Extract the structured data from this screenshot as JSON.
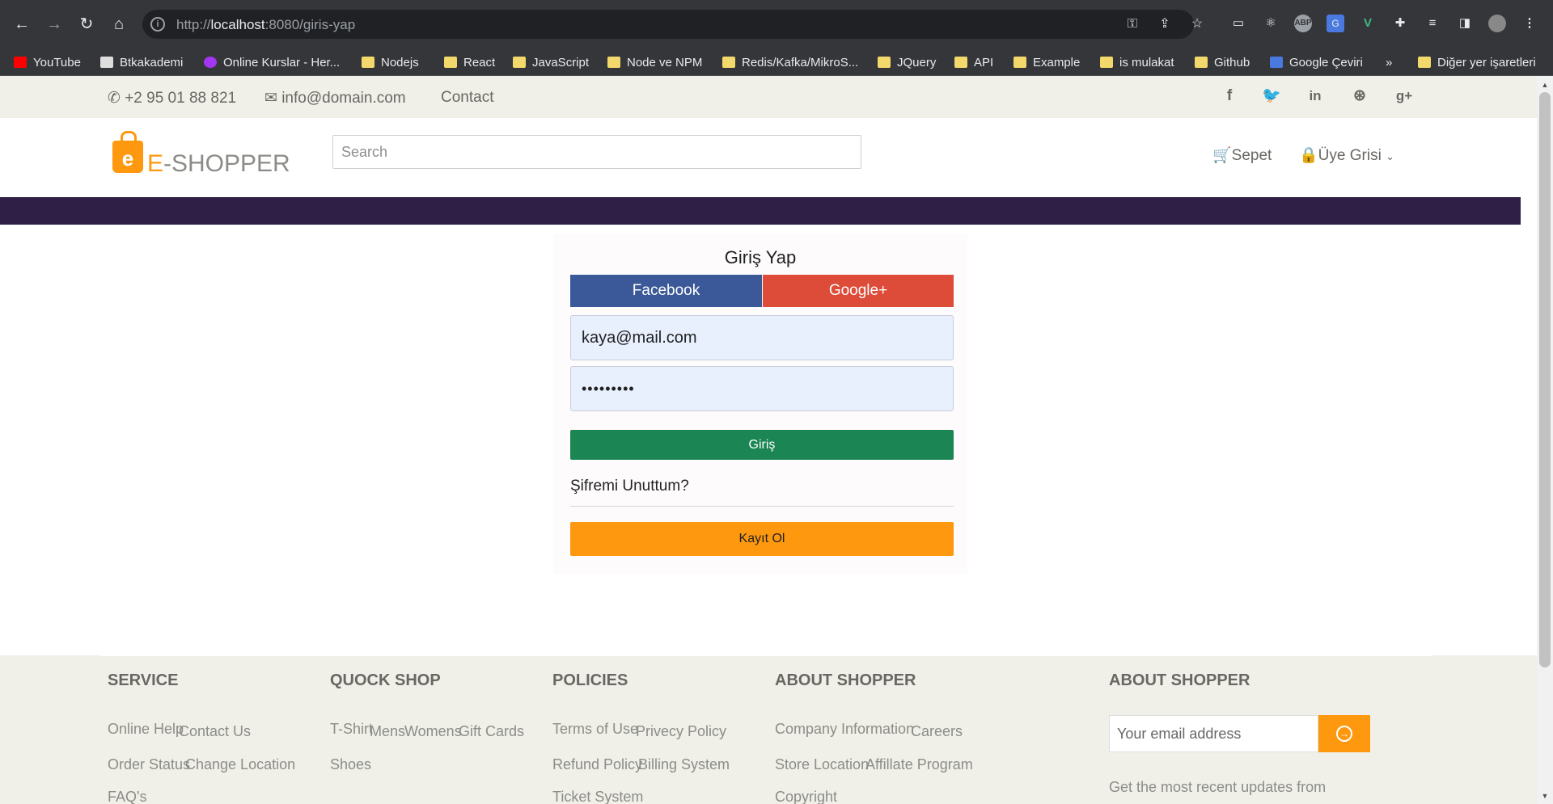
{
  "browser": {
    "url_scheme": "http://",
    "url_host": "localhost",
    "url_path": ":8080/giris-yap",
    "bookmarks": [
      {
        "label": "YouTube",
        "icon": "youtube-icon"
      },
      {
        "label": "Btkakademi",
        "icon": "btk-icon"
      },
      {
        "label": "Online Kurslar - Her...",
        "icon": "udemy-icon"
      },
      {
        "label": "Nodejs",
        "icon": "folder-icon"
      },
      {
        "label": "React",
        "icon": "folder-icon"
      },
      {
        "label": "JavaScript",
        "icon": "folder-icon"
      },
      {
        "label": "Node ve NPM",
        "icon": "folder-icon"
      },
      {
        "label": "Redis/Kafka/MikroS...",
        "icon": "folder-icon"
      },
      {
        "label": "JQuery",
        "icon": "folder-icon"
      },
      {
        "label": "API",
        "icon": "folder-icon"
      },
      {
        "label": "Example",
        "icon": "folder-icon"
      },
      {
        "label": "is mulakat",
        "icon": "folder-icon"
      },
      {
        "label": "Github",
        "icon": "folder-icon"
      },
      {
        "label": "Google Çeviri",
        "icon": "google-translate-icon"
      }
    ],
    "overflow": "»",
    "other_bookmarks": "Diğer yer işaretleri"
  },
  "topbar": {
    "phone": "+2 95 01 88 821",
    "email": "info@domain.com",
    "contact": "Contact"
  },
  "header": {
    "logo_e": "E",
    "logo_rest": "-SHOPPER",
    "search_placeholder": "Search",
    "cart": "Sepet",
    "member": "Üye Grisi"
  },
  "login": {
    "title": "Giriş Yap",
    "facebook": "Facebook",
    "google": "Google+",
    "email_value": "kaya@mail.com",
    "password_value": "•••••••••",
    "submit": "Giriş",
    "forgot": "Şifremi Unuttum?",
    "register": "Kayıt Ol"
  },
  "footer": {
    "service": {
      "title": "SERVICE",
      "rows": [
        "Online Help",
        "Contact Us",
        "Order Status",
        "Change Location",
        "FAQ's"
      ]
    },
    "quick_shop": {
      "title": "QUOCK SHOP",
      "rows": [
        "T-Shirt",
        "Mens",
        "Womens",
        "Gift Cards",
        "Shoes"
      ]
    },
    "policies": {
      "title": "POLICIES",
      "rows": [
        "Terms of Use",
        "Privecy Policy",
        "Refund Policy",
        "Billing System",
        "Ticket System"
      ]
    },
    "about": {
      "title": "ABOUT SHOPPER",
      "rows": [
        "Company Information",
        "Careers",
        "Store Location",
        "Affillate Program",
        "Copyright"
      ]
    },
    "about2": {
      "title": "ABOUT SHOPPER",
      "email_placeholder": "Your email address",
      "text": "Get the most recent updates from"
    }
  },
  "colors": {
    "accent": "#fe980f",
    "purple_bar": "#2f1e46",
    "login_green": "#1b8553",
    "facebook": "#3b5998",
    "google": "#dd4b39"
  }
}
